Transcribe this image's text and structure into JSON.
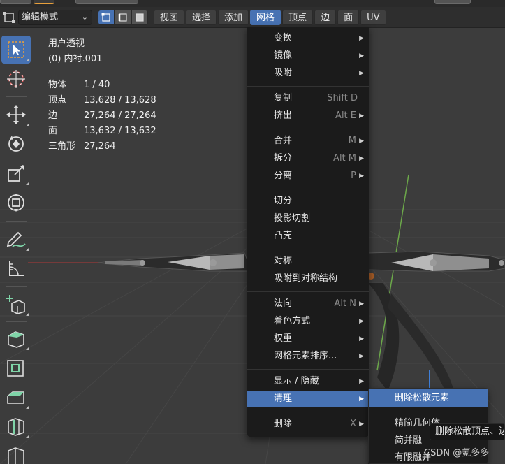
{
  "header": {
    "mode_label": "编辑模式",
    "menus": [
      "视图",
      "选择",
      "添加",
      "网格",
      "顶点",
      "边",
      "面",
      "UV"
    ],
    "open_menu": "网格"
  },
  "overlay": {
    "title": "用户透视",
    "subtitle": "(0) 内衬.001",
    "stats": [
      {
        "k": "物体",
        "v": "1 / 40"
      },
      {
        "k": "顶点",
        "v": "13,628 / 13,628"
      },
      {
        "k": "边",
        "v": "27,264 / 27,264"
      },
      {
        "k": "面",
        "v": "13,632 / 13,632"
      },
      {
        "k": "三角形",
        "v": "27,264"
      }
    ]
  },
  "mesh_menu": {
    "items": [
      {
        "label": "变换",
        "shortcut": "",
        "submenu": true
      },
      {
        "label": "镜像",
        "shortcut": "",
        "submenu": true
      },
      {
        "label": "吸附",
        "shortcut": "",
        "submenu": true
      },
      {
        "label": "复制",
        "shortcut": "Shift D",
        "submenu": false
      },
      {
        "label": "挤出",
        "shortcut": "Alt E",
        "submenu": true
      },
      {
        "label": "合并",
        "shortcut": "M",
        "submenu": true
      },
      {
        "label": "拆分",
        "shortcut": "Alt M",
        "submenu": true
      },
      {
        "label": "分离",
        "shortcut": "P",
        "submenu": true
      },
      {
        "label": "切分",
        "shortcut": "",
        "submenu": false
      },
      {
        "label": "投影切割",
        "shortcut": "",
        "submenu": false
      },
      {
        "label": "凸壳",
        "shortcut": "",
        "submenu": false
      },
      {
        "label": "对称",
        "shortcut": "",
        "submenu": false
      },
      {
        "label": "吸附到对称结构",
        "shortcut": "",
        "submenu": false
      },
      {
        "label": "法向",
        "shortcut": "Alt N",
        "submenu": true
      },
      {
        "label": "着色方式",
        "shortcut": "",
        "submenu": true
      },
      {
        "label": "权重",
        "shortcut": "",
        "submenu": true
      },
      {
        "label": "网格元素排序...",
        "shortcut": "",
        "submenu": true
      },
      {
        "label": "显示 / 隐藏",
        "shortcut": "",
        "submenu": true
      },
      {
        "label": "清理",
        "shortcut": "",
        "submenu": true
      },
      {
        "label": "删除",
        "shortcut": "X",
        "submenu": true
      }
    ],
    "highlighted": "清理"
  },
  "cleanup_submenu": {
    "items": [
      "删除松散元素",
      "精简几何体",
      "简并融",
      "有限融并"
    ],
    "highlighted": "删除松散元素"
  },
  "tooltip": "删除松散顶点、边",
  "watermark": "CSDN @氪多多",
  "colors": {
    "accent": "#4772b3",
    "menu_bg": "#1b1b1b",
    "header_bg": "#2e2e2e",
    "viewport_bg": "#3c3c3c",
    "tool_green": "#7fd4a8"
  }
}
